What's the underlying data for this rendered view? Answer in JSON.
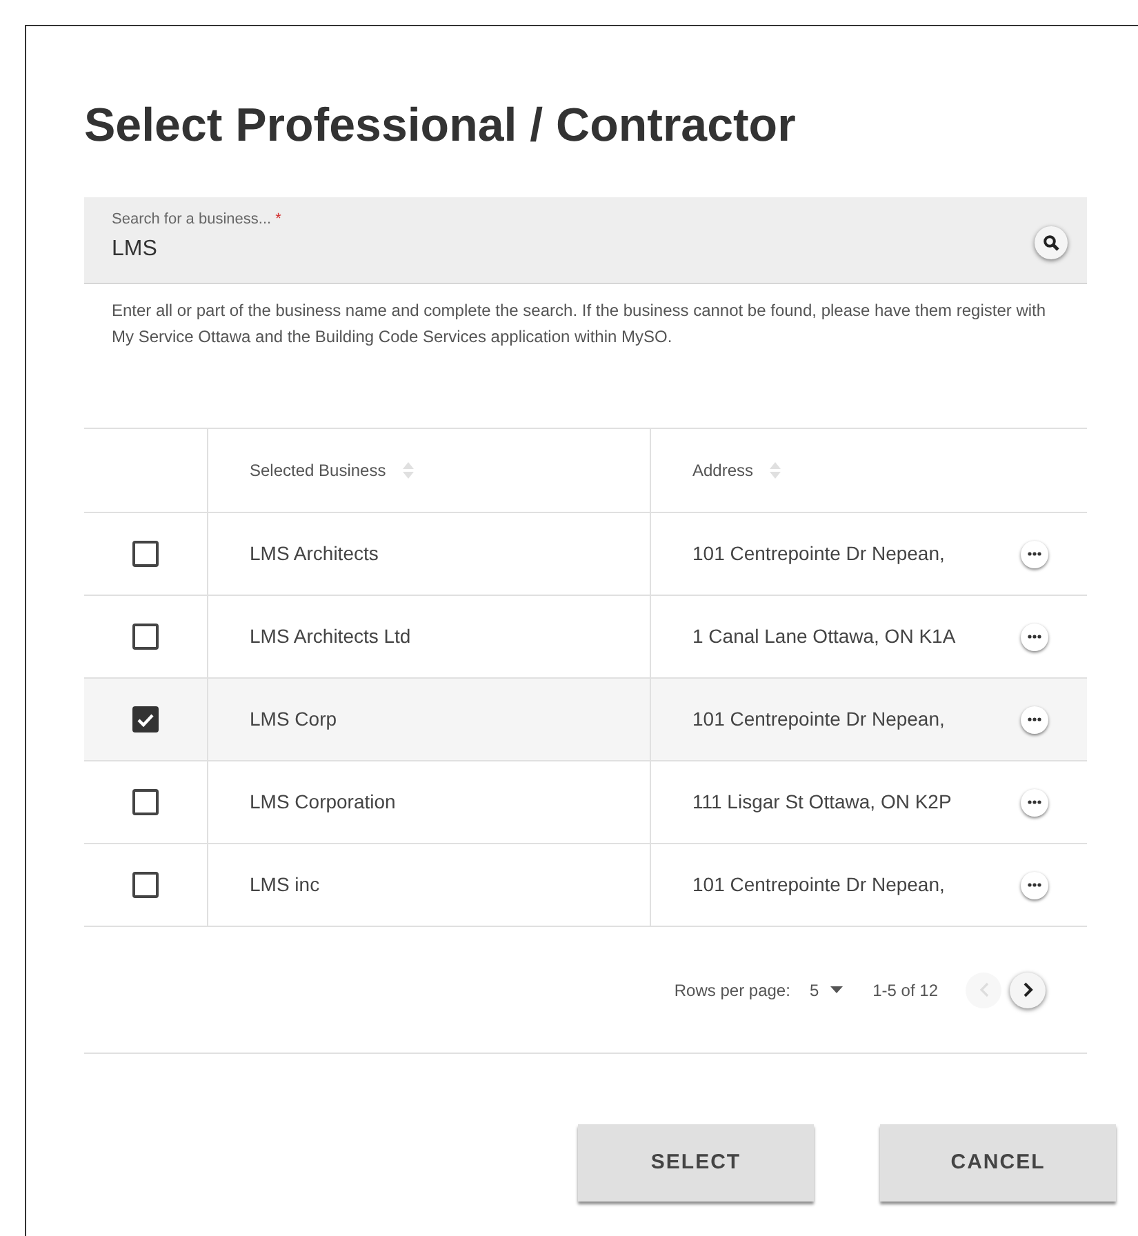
{
  "dialog": {
    "title": "Select Professional / Contractor"
  },
  "search": {
    "label": "Search for a business...",
    "required_mark": "*",
    "value": "LMS"
  },
  "helper_text": "Enter all or part of the business name and complete the search. If the business cannot be found, please have them register with My Service Ottawa and the Building Code Services application within MySO.",
  "table": {
    "columns": [
      "Selected Business",
      "Address"
    ],
    "rows": [
      {
        "business": "LMS Architects",
        "address": "101 Centrepointe Dr Nepean,",
        "checked": false
      },
      {
        "business": "LMS Architects Ltd",
        "address": "1 Canal Lane Ottawa, ON K1A",
        "checked": false
      },
      {
        "business": "LMS Corp",
        "address": "101 Centrepointe Dr Nepean,",
        "checked": true
      },
      {
        "business": "LMS Corporation",
        "address": "111 Lisgar St Ottawa, ON K2P",
        "checked": false
      },
      {
        "business": "LMS inc",
        "address": "101 Centrepointe Dr Nepean,",
        "checked": false
      }
    ]
  },
  "pagination": {
    "rows_per_page_label": "Rows per page:",
    "rows_per_page": "5",
    "range": "1-5 of 12",
    "previous_disabled": true,
    "next_disabled": false
  },
  "buttons": [
    "SELECT",
    "CANCEL"
  ]
}
